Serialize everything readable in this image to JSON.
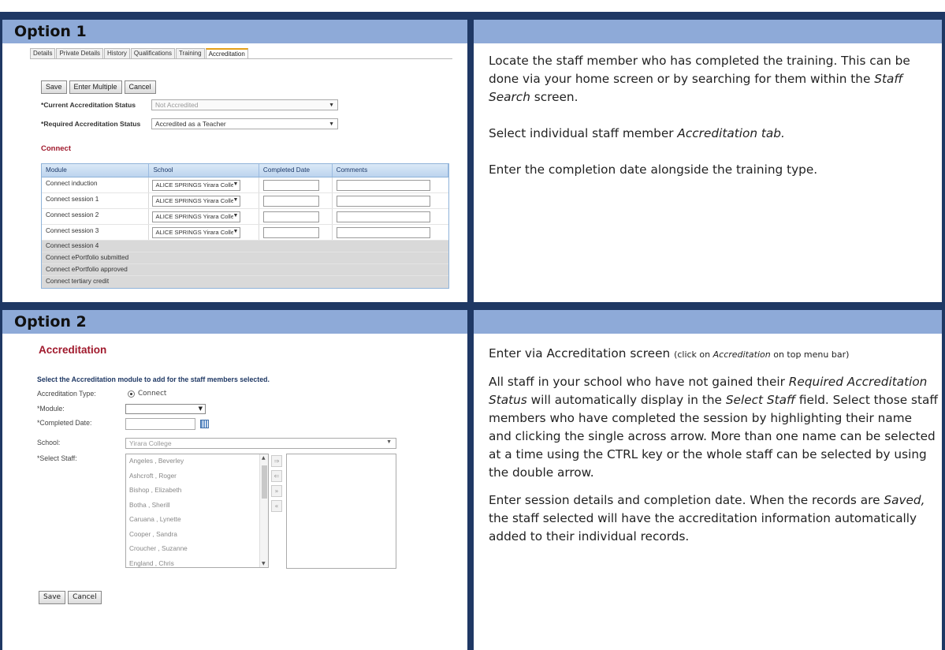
{
  "option1": {
    "title": "Option 1",
    "tabs": [
      "Details",
      "Private Details",
      "History",
      "Qualifications",
      "Training",
      "Accreditation"
    ],
    "buttons": [
      "Save",
      "Enter Multiple",
      "Cancel"
    ],
    "current_status_label": "*Current Accreditation Status",
    "current_status_value": "Not Accredited",
    "required_status_label": "*Required Accreditation Status",
    "required_status_value": "Accredited as a Teacher",
    "section_title": "Connect",
    "grid_headers": [
      "Module",
      "School",
      "Completed Date",
      "Comments"
    ],
    "grid_rows": [
      {
        "module": "Connect induction",
        "school": "ALICE SPRINGS Yirara Colle",
        "editable": true
      },
      {
        "module": "Connect session 1",
        "school": "ALICE SPRINGS Yirara Colle",
        "editable": true
      },
      {
        "module": "Connect session 2",
        "school": "ALICE SPRINGS Yirara Colle",
        "editable": true
      },
      {
        "module": "Connect session 3",
        "school": "ALICE SPRINGS Yirara Colle",
        "editable": true
      },
      {
        "module": "Connect session 4",
        "editable": false
      },
      {
        "module": "Connect ePortfolio submitted",
        "editable": false
      },
      {
        "module": "Connect ePortfolio approved",
        "editable": false
      },
      {
        "module": "Connect tertiary credit",
        "editable": false
      }
    ],
    "instructions": {
      "p1_a": "Locate the staff member who has completed the training. This can be done via your home screen or by searching for them within the ",
      "p1_em": "Staff Search",
      "p1_b": " screen.",
      "p2_a": "Select individual staff member ",
      "p2_em": "Accreditation tab.",
      "p3": "Enter the completion date alongside the training type."
    }
  },
  "option2": {
    "title": "Option 2",
    "screen_title": "Accreditation",
    "subtitle": "Select the Accreditation module to add for the staff members selected.",
    "type_label": "Accreditation Type:",
    "type_value": "Connect",
    "module_label": "*Module:",
    "date_label": "*Completed Date:",
    "school_label": "School:",
    "school_value": "Yirara College",
    "staff_label": "*Select Staff:",
    "staff": [
      "Angeles , Beverley",
      "Ashcroft , Roger",
      "Bishop , Elizabeth",
      "Botha , Sherill",
      "Caruana , Lynette",
      "Cooper , Sandra",
      "Croucher , Suzanne",
      "England , Chris"
    ],
    "arrows": [
      "⇒",
      "⇐",
      "»",
      "«"
    ],
    "buttons": [
      "Save",
      "Cancel"
    ],
    "instructions": {
      "p1_a": "Enter via Accreditation screen ",
      "p1_small_a": "(click on ",
      "p1_small_em": "Accreditation",
      "p1_small_b": " on top menu bar)",
      "p2_a": "All staff in your school who have not gained their ",
      "p2_em1": "Required Accreditation Status",
      "p2_b": " will automatically display in the ",
      "p2_em2": "Select Staff",
      "p2_c": " field. Select those staff members who have completed the session by highlighting their name and clicking the single across arrow. More than one name can be selected at a time using the CTRL key or the whole staff can be selected by using the double arrow.",
      "p3_a": "Enter session details and completion date. When the records are ",
      "p3_em": "Saved,",
      "p3_b": " the staff selected will have the accreditation information automatically added to their individual records."
    }
  },
  "colors": {
    "header_bg": "#8eaad8",
    "header_border": "#1f3864",
    "accent_red": "#a0192c",
    "navy": "#1f3864"
  }
}
